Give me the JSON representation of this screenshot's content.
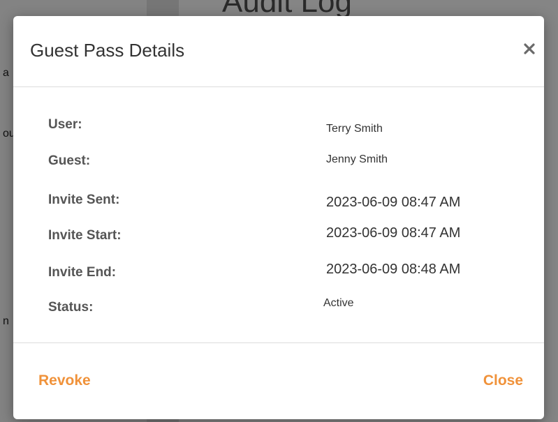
{
  "background": {
    "page_title": "Audit Log",
    "fragments": [
      "a",
      "ou",
      "n"
    ]
  },
  "modal": {
    "title": "Guest Pass Details",
    "close_icon": "close-icon",
    "fields": [
      {
        "label": "User:",
        "value": "Terry Smith"
      },
      {
        "label": "Guest:",
        "value": "Jenny Smith"
      },
      {
        "label": "Invite Sent:",
        "value": "2023-06-09 08:47 AM"
      },
      {
        "label": "Invite Start:",
        "value": "2023-06-09 08:47 AM"
      },
      {
        "label": "Invite End:",
        "value": "2023-06-09 08:48 AM"
      },
      {
        "label": "Status:",
        "value": "Active"
      }
    ],
    "footer": {
      "revoke_label": "Revoke",
      "close_label": "Close"
    }
  },
  "colors": {
    "accent": "#f0923a",
    "overlay": "#808080",
    "label": "#555555",
    "value": "#333333"
  }
}
